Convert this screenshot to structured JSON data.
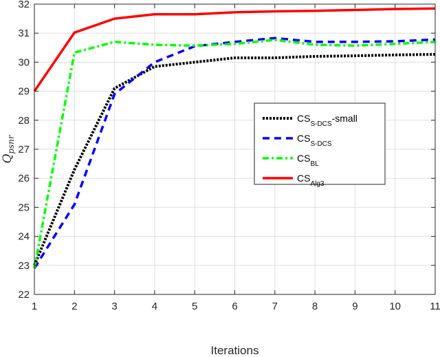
{
  "chart_data": {
    "type": "line",
    "title": "",
    "xlabel": "Iterations",
    "ylabel": "Q",
    "ylabel_subscript": "psnr",
    "xlim": [
      1,
      11
    ],
    "ylim": [
      22,
      32
    ],
    "xticks": [
      1,
      2,
      3,
      4,
      5,
      6,
      7,
      8,
      9,
      10,
      11
    ],
    "yticks": [
      22,
      23,
      24,
      25,
      26,
      27,
      28,
      29,
      30,
      31,
      32
    ],
    "grid": true,
    "legend_position": "center-right",
    "x": [
      1,
      2,
      3,
      4,
      5,
      6,
      7,
      8,
      9,
      10,
      11
    ],
    "series": [
      {
        "name": "CS_S-DCS-small",
        "label_main": "CS",
        "label_sub": "S-DCS",
        "label_suffix": "-small",
        "color": "#000000",
        "style": "dotted",
        "values": [
          23.0,
          26.3,
          29.1,
          29.85,
          30.0,
          30.15,
          30.15,
          30.2,
          30.22,
          30.25,
          30.27
        ]
      },
      {
        "name": "CS_S-DCS",
        "label_main": "CS",
        "label_sub": "S-DCS",
        "label_suffix": "",
        "color": "#0000ff",
        "style": "dashed",
        "values": [
          22.9,
          25.1,
          28.9,
          30.0,
          30.55,
          30.7,
          30.83,
          30.7,
          30.7,
          30.72,
          30.78
        ]
      },
      {
        "name": "CS_BL",
        "label_main": "CS",
        "label_sub": "BL",
        "label_suffix": "",
        "color": "#00ff00",
        "style": "dashdot",
        "values": [
          22.9,
          30.33,
          30.7,
          30.6,
          30.57,
          30.63,
          30.77,
          30.6,
          30.57,
          30.63,
          30.7
        ]
      },
      {
        "name": "CS_Alg3",
        "label_main": "CS",
        "label_sub": "Alg3",
        "label_suffix": "",
        "color": "#ff0000",
        "style": "solid",
        "values": [
          29.0,
          31.02,
          31.5,
          31.65,
          31.65,
          31.72,
          31.75,
          31.77,
          31.8,
          31.83,
          31.85
        ]
      }
    ]
  }
}
